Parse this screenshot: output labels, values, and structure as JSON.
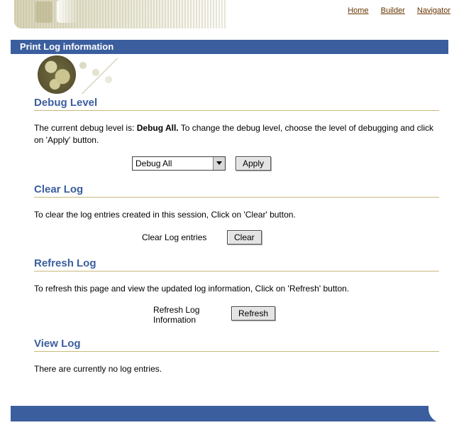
{
  "topnav": {
    "home": "Home",
    "builder": "Builder",
    "navigator": "Navigator"
  },
  "titlebar": {
    "title": "Print Log information"
  },
  "debug": {
    "heading": "Debug Level",
    "para_before": "The current debug level is: ",
    "current_level_strong": "Debug All.",
    "para_after": " To change the debug level, choose the level of debugging and click on 'Apply' button.",
    "select_value": "Debug All",
    "apply_btn": "Apply"
  },
  "clear": {
    "heading": "Clear Log",
    "para": "To clear the log entries created in this session, Click on 'Clear' button.",
    "label": "Clear Log entries",
    "btn": "Clear"
  },
  "refresh": {
    "heading": "Refresh Log",
    "para": "To refresh this page and view the updated log information, Click on 'Refresh' button.",
    "label_line1": "Refresh Log",
    "label_line2": "Information",
    "btn": "Refresh"
  },
  "view": {
    "heading": "View Log",
    "empty_msg": "There are currently no log entries."
  }
}
